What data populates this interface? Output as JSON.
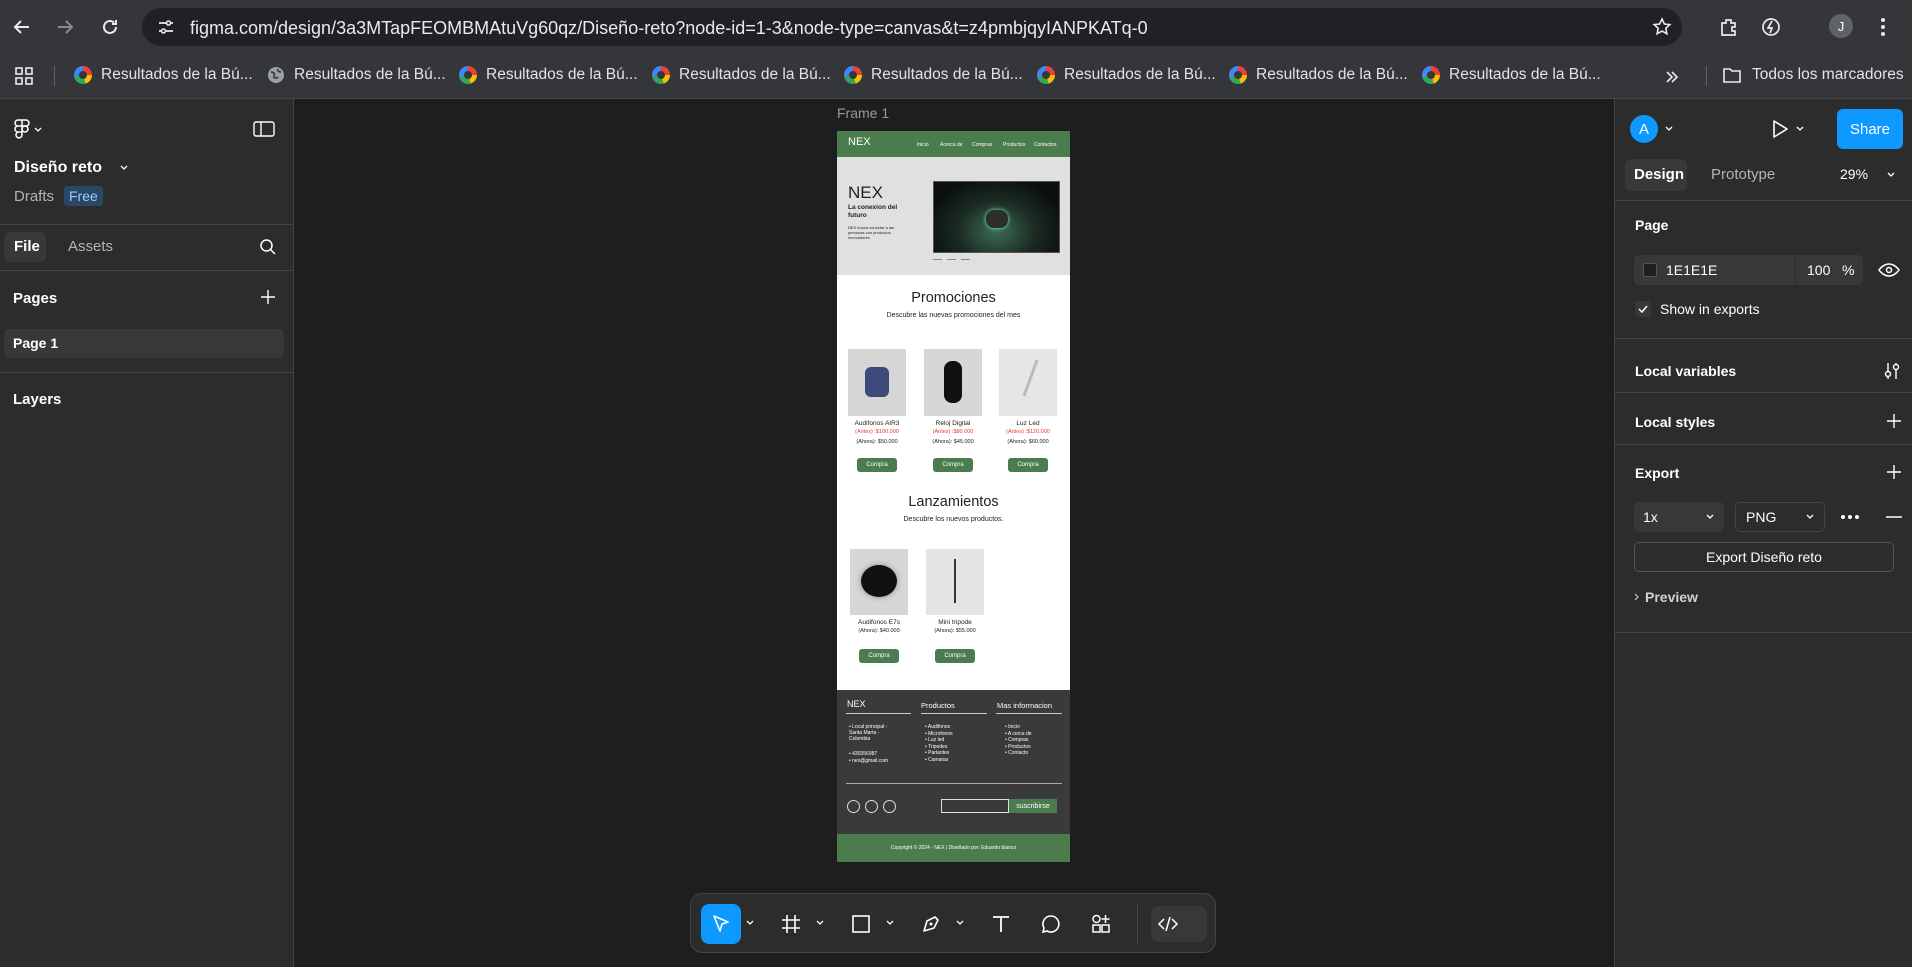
{
  "browser": {
    "url": "figma.com/design/3a3MTapFEOMBMAtuVg60qz/Diseño-reto?node-id=1-3&node-type=canvas&t=z4pmbjqyIANPKATq-0",
    "profile_initial": "J",
    "bookmarks": [
      "Resultados de la Bú...",
      "Resultados de la Bú...",
      "Resultados de la Bú...",
      "Resultados de la Bú...",
      "Resultados de la Bú...",
      "Resultados de la Bú...",
      "Resultados de la Bú...",
      "Resultados de la Bú..."
    ],
    "all_bookmarks": "Todos los marcadores"
  },
  "left_panel": {
    "file_name": "Diseño reto",
    "location": "Drafts",
    "plan_badge": "Free",
    "tabs": [
      "File",
      "Assets"
    ],
    "pages_heading": "Pages",
    "pages": [
      "Page 1"
    ],
    "layers_heading": "Layers"
  },
  "right_panel": {
    "avatar_initial": "A",
    "share_label": "Share",
    "tabs": [
      "Design",
      "Prototype"
    ],
    "zoom": "29%",
    "page_heading": "Page",
    "bg_color_hex": "1E1E1E",
    "bg_opacity": "100",
    "percent_sign": "%",
    "show_in_exports": "Show in exports",
    "local_variables": "Local variables",
    "local_styles": "Local styles",
    "export_heading": "Export",
    "export_scale": "1x",
    "export_format": "PNG",
    "export_button": "Export Diseño reto",
    "preview": "Preview"
  },
  "canvas": {
    "frame_label": "Frame 1",
    "design": {
      "brand": "NEX",
      "nav": [
        "Inicio",
        "Acerca de",
        "Compras",
        "Productos",
        "Contactos"
      ],
      "hero_title": "NEX",
      "hero_subtitle": "La conexion del futuro",
      "hero_body": "NEX busca conectar a las personas con productos innovadores",
      "promo_title": "Promociones",
      "promo_sub": "Descubre las nuevas promociones del mes",
      "promo_products": [
        {
          "name": "Audifonos AIR3",
          "before": "(Antes) :$100.000",
          "now": "(Ahora): $50.000"
        },
        {
          "name": "Reloj Digital",
          "before": "(Antes) :$80.000",
          "now": "(Ahora): $45.000"
        },
        {
          "name": "Luz Led",
          "before": "(Antes) :$120.000",
          "now": "(Ahora): $60.000"
        }
      ],
      "buy_label": "Compra",
      "launch_title": "Lanzamientos",
      "launch_sub": "Descubre los nuevos productos.",
      "launch_products": [
        {
          "name": "Audifonos E7s",
          "now": "(Ahora): $40.000"
        },
        {
          "name": "Mini tripode",
          "now": "(Ahora): $55.000"
        }
      ],
      "footer": {
        "col1_title": "NEX",
        "col1_items": [
          "Local principal - Santa Marta - Colombia",
          "430356987",
          "nex@gmail.com"
        ],
        "col2_title": "Productos",
        "col2_items": [
          "Audifonos",
          "Microfonos",
          "Luz led",
          "Tripodes",
          "Parlantes",
          "Camaras"
        ],
        "col3_title": "Mas informacion",
        "col3_items": [
          "Inicio",
          "A cerca de",
          "Compras",
          "Productos",
          "Contacto"
        ],
        "subscribe": "suscribirse",
        "copyright": "Copyright © 2024 - NEX | Diseñado por: Eduardo blanco"
      },
      "accent": "#4a7c4e",
      "price_before_color": "#e53935"
    }
  },
  "colors": {
    "figma_blue": "#0d99ff",
    "panel": "#2c2c2c",
    "canvas": "#1e1e1e"
  }
}
